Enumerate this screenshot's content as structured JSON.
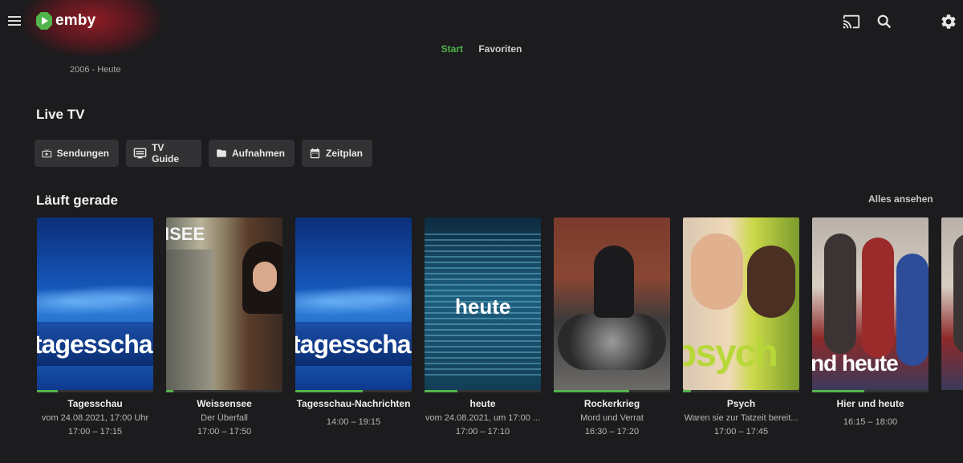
{
  "app": {
    "logo_text": "emby"
  },
  "tabs": [
    {
      "label": "Start",
      "active": true
    },
    {
      "label": "Favoriten",
      "active": false
    }
  ],
  "header_icons": [
    "cast-icon",
    "search-icon",
    "gear-icon"
  ],
  "year_text": "2006 - Heute",
  "live_tv": {
    "title": "Live TV",
    "buttons": [
      {
        "label": "Sendungen",
        "icon": "tv-icon"
      },
      {
        "label": "TV Guide",
        "icon": "guide-icon"
      },
      {
        "label": "Aufnahmen",
        "icon": "folder-icon"
      },
      {
        "label": "Zeitplan",
        "icon": "calendar-icon"
      }
    ]
  },
  "now_playing": {
    "title": "Läuft gerade",
    "see_all": "Alles ansehen",
    "items": [
      {
        "title": "Tagesschau",
        "subtitle": "vom 24.08.2021, 17:00 Uhr",
        "time": "17:00 – 17:15",
        "progress": 0.18,
        "poster_text": "tagesschau"
      },
      {
        "title": "Weissensee",
        "subtitle": "Der Überfall",
        "time": "17:00 – 17:50",
        "progress": 0.06,
        "poster_text": "ISEE"
      },
      {
        "title": "Tagesschau-Nachrichten",
        "subtitle": "",
        "time": "14:00 – 19:15",
        "progress": 0.58,
        "poster_text": "tagesschau"
      },
      {
        "title": "heute",
        "subtitle": "vom 24.08.2021, um 17:00 ...",
        "time": "17:00 – 17:10",
        "progress": 0.28,
        "poster_text": "heute"
      },
      {
        "title": "Rockerkrieg",
        "subtitle": "Mord und Verrat",
        "time": "16:30 – 17:20",
        "progress": 0.65,
        "poster_text": ""
      },
      {
        "title": "Psych",
        "subtitle": "Waren sie zur Tatzeit bereit...",
        "time": "17:00 – 17:45",
        "progress": 0.07,
        "poster_text": "psych"
      },
      {
        "title": "Hier und heute",
        "subtitle": "",
        "time": "16:15 – 18:00",
        "progress": 0.45,
        "poster_text": "nd heute"
      }
    ]
  },
  "colors": {
    "accent": "#52b54b",
    "background": "#1c1b1d",
    "button": "#323133"
  }
}
